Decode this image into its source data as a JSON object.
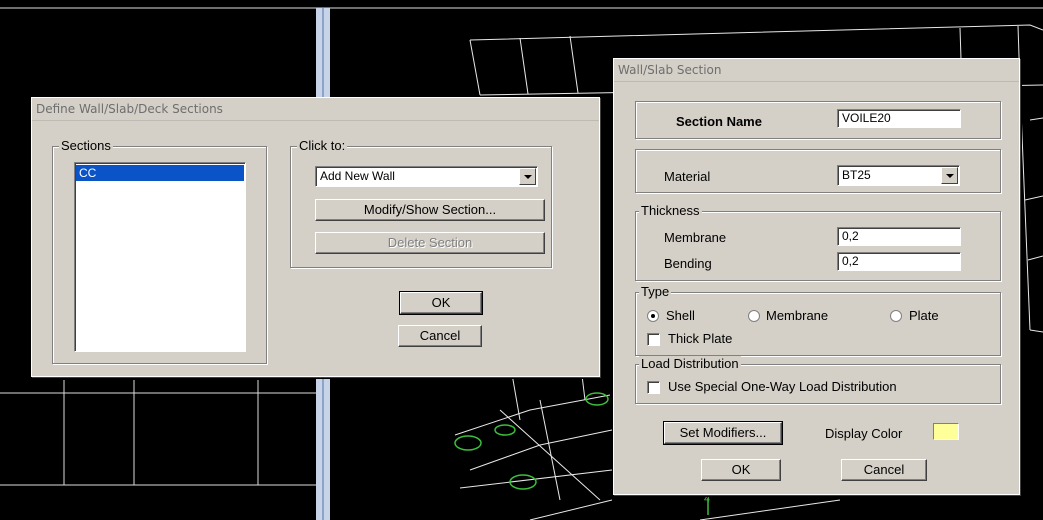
{
  "define_dialog": {
    "title": "Define Wall/Slab/Deck Sections",
    "sections_legend": "Sections",
    "sections": [
      "CC"
    ],
    "click_to_legend": "Click to:",
    "click_to_selected": "Add New Wall",
    "modify_button": "Modify/Show Section...",
    "delete_button": "Delete Section",
    "ok_button": "OK",
    "cancel_button": "Cancel"
  },
  "section_dialog": {
    "title": "Wall/Slab Section",
    "section_name_label": "Section Name",
    "section_name_value": "VOILE20",
    "material_label": "Material",
    "material_value": "BT25",
    "thickness_legend": "Thickness",
    "membrane_label": "Membrane",
    "membrane_value": "0,2",
    "bending_label": "Bending",
    "bending_value": "0,2",
    "type_legend": "Type",
    "type_shell": "Shell",
    "type_membrane": "Membrane",
    "type_plate": "Plate",
    "type_selected": "Shell",
    "thick_plate_label": "Thick Plate",
    "thick_plate_checked": false,
    "load_distribution_legend": "Load Distribution",
    "one_way_label": "Use Special One-Way Load Distribution",
    "one_way_checked": false,
    "set_modifiers_button": "Set Modifiers...",
    "display_color_label": "Display Color",
    "display_color": "#ffff99",
    "ok_button": "OK",
    "cancel_button": "Cancel"
  },
  "colors": {
    "selection": "#0a54c8",
    "dialog_face": "#d4d0c8",
    "model_lines": "#ffffff",
    "joint_markers": "#3cbe3c"
  }
}
